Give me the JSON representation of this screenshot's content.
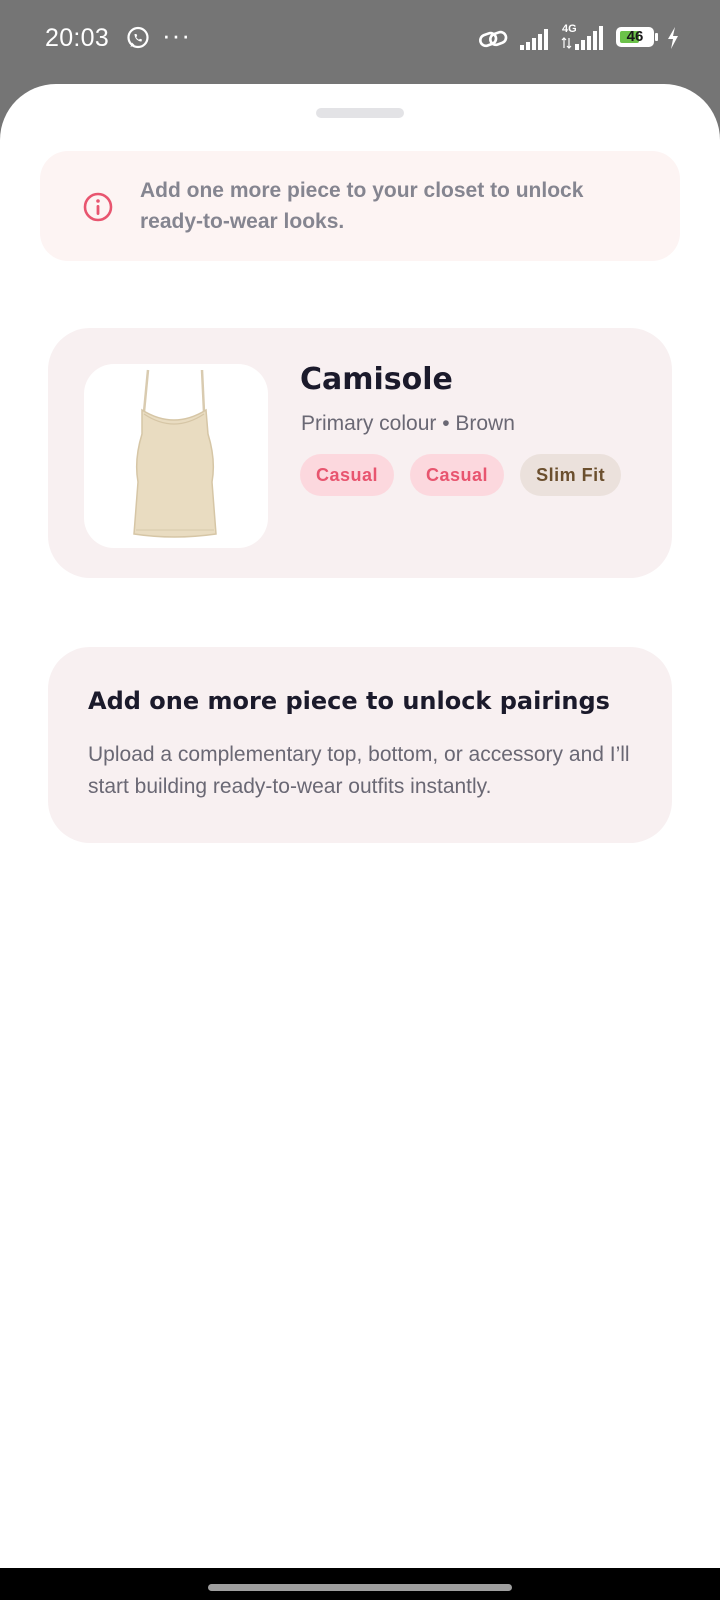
{
  "status_bar": {
    "time": "20:03",
    "more": "···",
    "network_type": "4G",
    "battery": "46",
    "icons": [
      "whatsapp-icon",
      "link-icon",
      "signal-icon",
      "signal-4g-icon",
      "battery-icon",
      "charging-icon"
    ]
  },
  "banner": {
    "icon": "info-icon",
    "text": "Add one more piece to your closet to unlock ready-to-wear looks."
  },
  "item": {
    "name": "Camisole",
    "meta": "Primary colour • Brown",
    "tags": [
      "Casual",
      "Casual",
      "Slim Fit"
    ]
  },
  "unlock": {
    "title": "Add one more piece to unlock pairings",
    "body": "Upload a complementary top, bottom, or accessory and I’ll start building ready-to-wear outfits instantly."
  },
  "colors": {
    "accent": "#e8556f",
    "card_bg": "#f8f0f1",
    "banner_bg": "#fdf4f3",
    "tag_brown_bg": "#ebe1dc"
  }
}
